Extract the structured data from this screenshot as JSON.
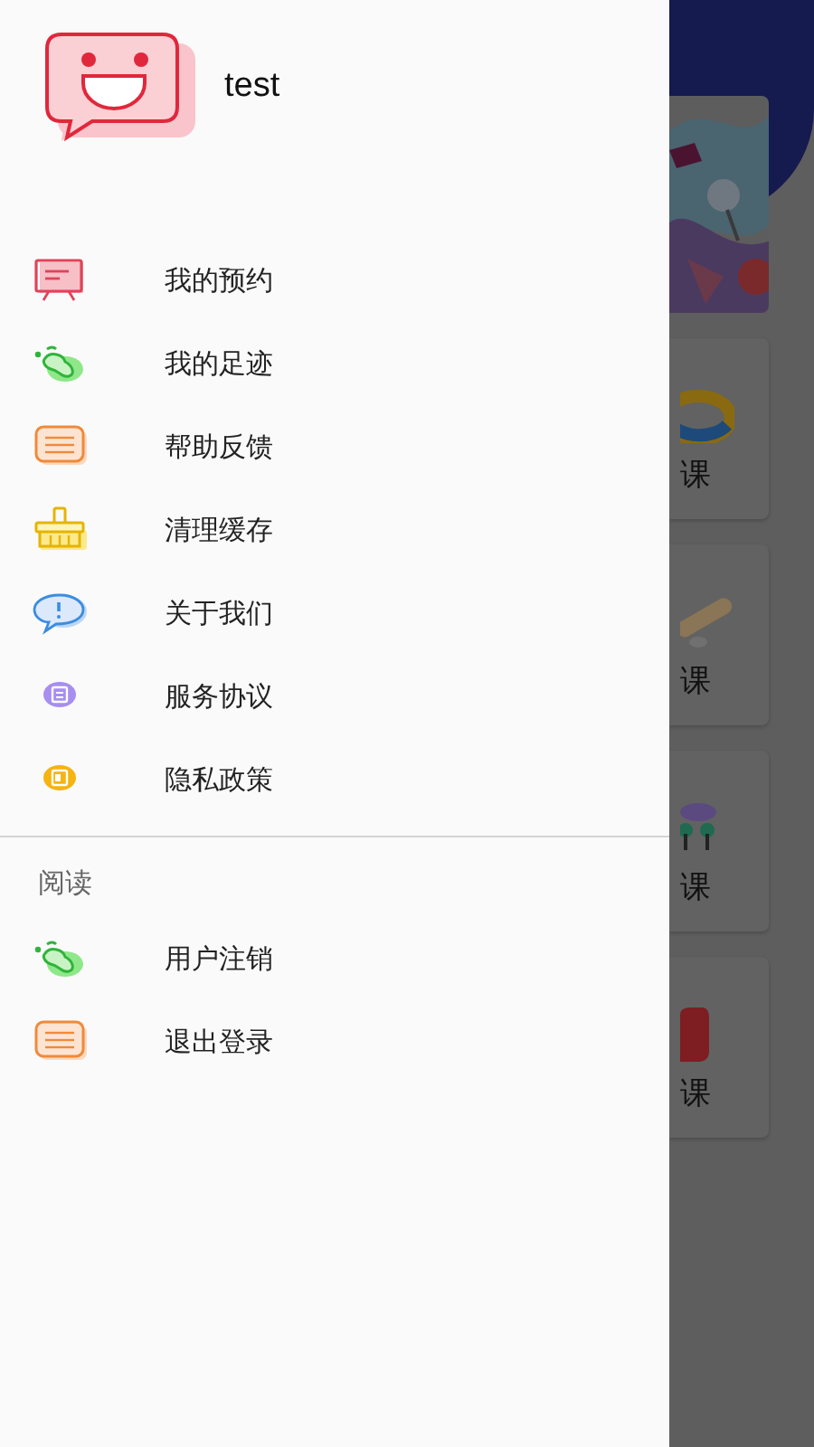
{
  "background": {
    "cards": [
      {
        "kind": "picture"
      },
      {
        "kind": "course",
        "label": "课"
      },
      {
        "kind": "course",
        "label": "课"
      },
      {
        "kind": "course",
        "label": "课"
      },
      {
        "kind": "course",
        "label": "课"
      }
    ]
  },
  "drawer": {
    "profile": {
      "username": "test"
    },
    "menu": [
      {
        "label": "我的预约"
      },
      {
        "label": "我的足迹"
      },
      {
        "label": "帮助反馈"
      },
      {
        "label": "清理缓存"
      },
      {
        "label": "关于我们"
      },
      {
        "label": "服务协议"
      },
      {
        "label": "隐私政策"
      }
    ],
    "section": {
      "title": "阅读",
      "items": [
        {
          "label": "用户注销"
        },
        {
          "label": "退出登录"
        }
      ]
    }
  }
}
